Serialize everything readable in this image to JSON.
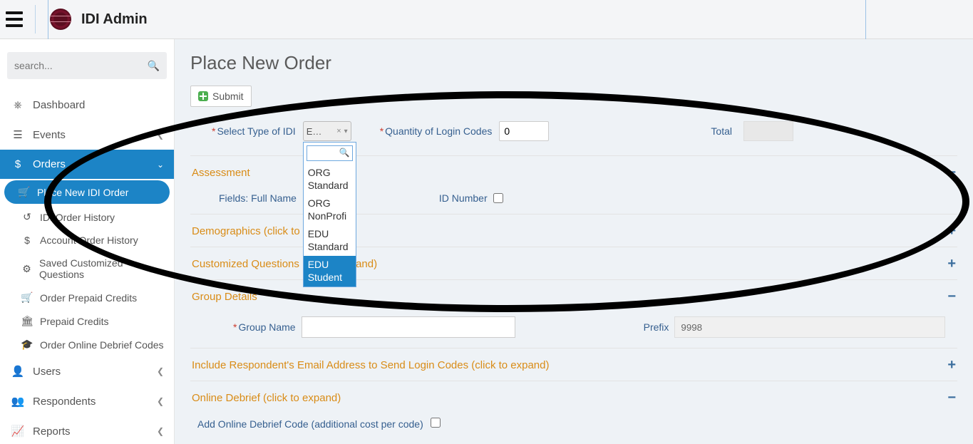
{
  "app": {
    "title": "IDI Admin"
  },
  "sidebar": {
    "search_placeholder": "search...",
    "items": [
      {
        "label": "Dashboard"
      },
      {
        "label": "Events"
      },
      {
        "label": "Orders"
      },
      {
        "label": "Users"
      },
      {
        "label": "Respondents"
      },
      {
        "label": "Reports"
      }
    ],
    "orders_sub": [
      {
        "label": "Place New IDI Order"
      },
      {
        "label": "IDI Order History"
      },
      {
        "label": "Account Order History"
      },
      {
        "label": "Saved Customized Questions"
      },
      {
        "label": "Order Prepaid Credits"
      },
      {
        "label": "Prepaid Credits"
      },
      {
        "label": "Order Online Debrief Codes"
      }
    ]
  },
  "page": {
    "title": "Place New Order",
    "submit": "Submit"
  },
  "form": {
    "type_label": "Select Type of IDI",
    "type_selected_short": "E…",
    "type_options": [
      "ORG Standard",
      "ORG NonProfi",
      "EDU Standard",
      "EDU Student"
    ],
    "type_dropdown_query": "",
    "qty_label": "Quantity of Login Codes",
    "qty_value": "0",
    "total_label": "Total",
    "total_value": ""
  },
  "sections": {
    "assessment": {
      "title": "Assessment",
      "toggle": "−",
      "full_name_label": "Fields: Full Name",
      "id_number_label": "ID Number"
    },
    "demographics": {
      "title": "Demographics (click to e",
      "toggle": "+"
    },
    "custom_q": {
      "title": "Customized Questions (",
      "suffix": "and)",
      "toggle": "+"
    },
    "group": {
      "title": "Group Details",
      "toggle": "−",
      "group_name_label": "Group Name",
      "group_name_value": "",
      "prefix_label": "Prefix",
      "prefix_value": "9998"
    },
    "include_email": {
      "title": "Include Respondent's Email Address to Send Login Codes (click to expand)",
      "toggle": "+"
    },
    "online_debrief": {
      "title": "Online Debrief (click to expand)",
      "toggle": "−",
      "add_code_label": "Add Online Debrief Code (additional cost per code)"
    }
  }
}
